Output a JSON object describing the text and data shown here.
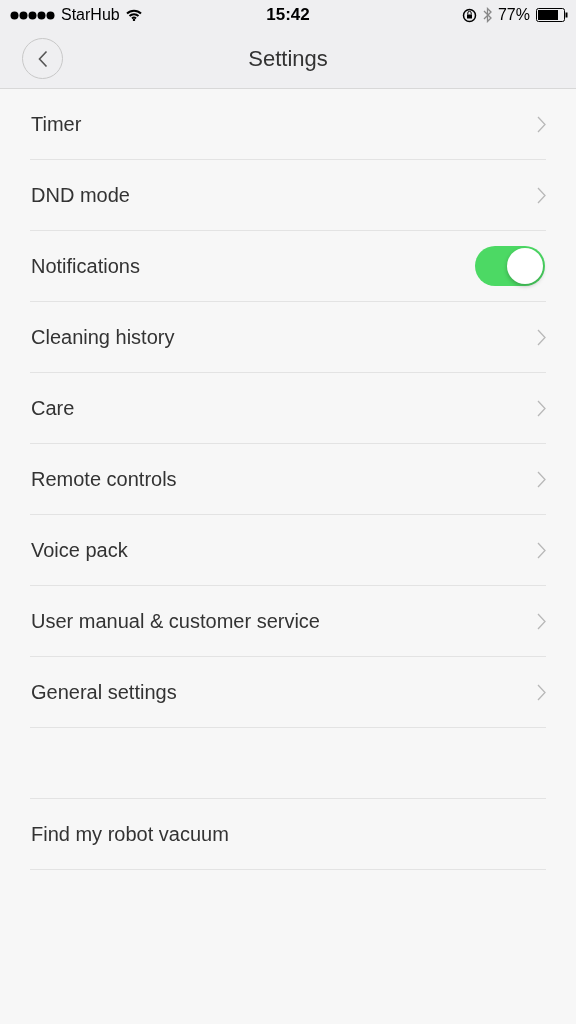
{
  "status_bar": {
    "carrier": "StarHub",
    "time": "15:42",
    "battery": "77%"
  },
  "header": {
    "title": "Settings"
  },
  "groups": [
    {
      "items": [
        {
          "label": "Timer",
          "kind": "link"
        },
        {
          "label": "DND mode",
          "kind": "link"
        },
        {
          "label": "Notifications",
          "kind": "toggle",
          "on": true
        },
        {
          "label": "Cleaning history",
          "kind": "link"
        },
        {
          "label": "Care",
          "kind": "link"
        },
        {
          "label": "Remote controls",
          "kind": "link"
        },
        {
          "label": "Voice pack",
          "kind": "link"
        },
        {
          "label": "User manual & customer service",
          "kind": "link"
        },
        {
          "label": "General settings",
          "kind": "link"
        }
      ]
    },
    {
      "items": [
        {
          "label": "Find my robot vacuum",
          "kind": "plain"
        }
      ]
    }
  ]
}
